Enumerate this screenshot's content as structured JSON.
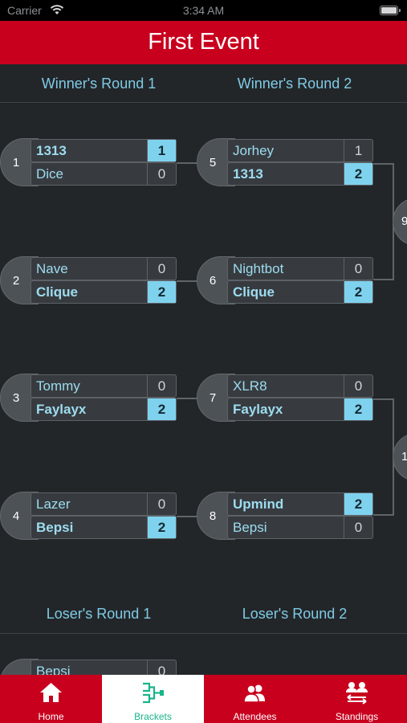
{
  "status_bar": {
    "carrier": "Carrier",
    "time": "3:34 AM"
  },
  "header": {
    "title": "First Event"
  },
  "winners": {
    "round1_title": "Winner's Round 1",
    "round2_title": "Winner's Round 2",
    "matches": [
      {
        "number": "1",
        "top": {
          "name": "1313",
          "score": "1"
        },
        "bottom": {
          "name": "Dice",
          "score": "0"
        }
      },
      {
        "number": "2",
        "top": {
          "name": "Nave",
          "score": "0"
        },
        "bottom": {
          "name": "Clique",
          "score": "2"
        }
      },
      {
        "number": "3",
        "top": {
          "name": "Tommy",
          "score": "0"
        },
        "bottom": {
          "name": "Faylayx",
          "score": "2"
        }
      },
      {
        "number": "4",
        "top": {
          "name": "Lazer",
          "score": "0"
        },
        "bottom": {
          "name": "Bepsi",
          "score": "2"
        }
      },
      {
        "number": "5",
        "top": {
          "name": "Jorhey",
          "score": "1"
        },
        "bottom": {
          "name": "1313",
          "score": "2"
        }
      },
      {
        "number": "6",
        "top": {
          "name": "Nightbot",
          "score": "0"
        },
        "bottom": {
          "name": "Clique",
          "score": "2"
        }
      },
      {
        "number": "7",
        "top": {
          "name": "XLR8",
          "score": "0"
        },
        "bottom": {
          "name": "Faylayx",
          "score": "2"
        }
      },
      {
        "number": "8",
        "top": {
          "name": "Upmind",
          "score": "2"
        },
        "bottom": {
          "name": "Bepsi",
          "score": "0"
        }
      }
    ],
    "partial_matches": [
      {
        "number": "9"
      },
      {
        "number": "1"
      }
    ]
  },
  "losers": {
    "round1_title": "Loser's Round 1",
    "round2_title": "Loser's Round 2",
    "partial_match": {
      "name": "Bepsi",
      "score": "0"
    }
  },
  "tabs": [
    {
      "label": "Home",
      "icon": "home-icon",
      "active": false
    },
    {
      "label": "Brackets",
      "icon": "brackets-icon",
      "active": true
    },
    {
      "label": "Attendees",
      "icon": "attendees-icon",
      "active": false
    },
    {
      "label": "Standings",
      "icon": "standings-icon",
      "active": false
    }
  ],
  "colors": {
    "brand_red": "#c8001e",
    "winner_highlight": "#7fd2ee",
    "accent_green": "#19b48a",
    "background": "#232629"
  }
}
